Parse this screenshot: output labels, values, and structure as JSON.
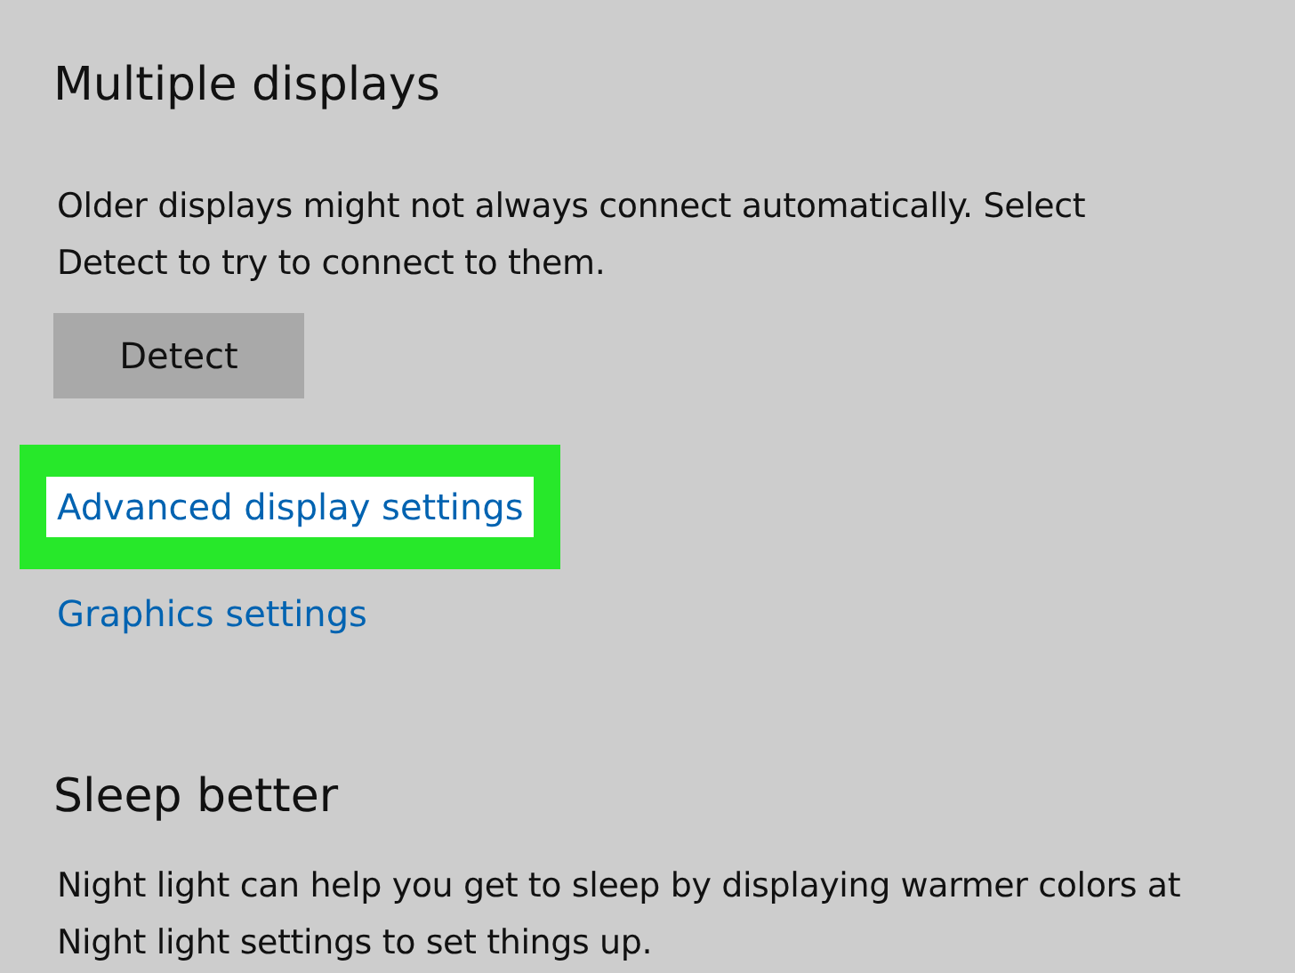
{
  "sections": [
    {
      "title": "Multiple displays",
      "lines": [
        "Older displays might not always connect automatically. Select",
        "Detect to try to connect to them."
      ],
      "button": "Detect",
      "links": [
        {
          "label": "Advanced display settings",
          "highlighted": true
        },
        {
          "label": "Graphics settings",
          "highlighted": false
        }
      ]
    },
    {
      "title": "Sleep better",
      "lines": [
        "Night light can help you get to sleep by displaying warmer colors at",
        "Night light settings to set things up."
      ]
    }
  ]
}
